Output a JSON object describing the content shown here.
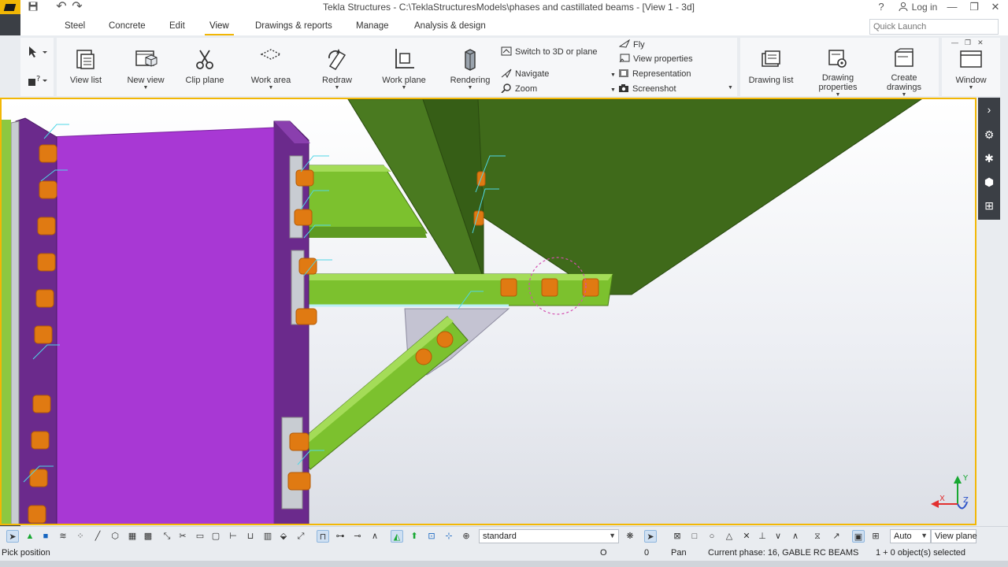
{
  "window": {
    "title": "Tekla Structures - C:\\TeklaStructuresModels\\phases and castillated beams  - [View 1 - 3d]",
    "help_glyph": "?",
    "login_label": "Log in",
    "minimize_glyph": "—",
    "restore_glyph": "❐",
    "close_glyph": "✕"
  },
  "quick_access": {
    "undo_glyph": "↶",
    "redo_glyph": "↷"
  },
  "menu": {
    "tabs": [
      "Steel",
      "Concrete",
      "Edit",
      "View",
      "Drawings & reports",
      "Manage",
      "Analysis & design"
    ],
    "active_tab": "View",
    "quick_launch_placeholder": "Quick Launch"
  },
  "ribbon": {
    "buttons": {
      "view_list": "View list",
      "new_view": "New view",
      "clip_plane": "Clip plane",
      "work_area": "Work area",
      "redraw": "Redraw",
      "work_plane": "Work plane",
      "rendering": "Rendering",
      "drawing_list": "Drawing list",
      "drawing_properties_1": "Drawing",
      "drawing_properties_2": "properties",
      "create_drawings_1": "Create",
      "create_drawings_2": "drawings",
      "window": "Window"
    },
    "small_items": {
      "switch_3d": "Switch to 3D or plane",
      "navigate": "Navigate",
      "zoom": "Zoom",
      "fly": "Fly",
      "view_properties": "View properties",
      "representation": "Representation",
      "screenshot": "Screenshot"
    }
  },
  "viewport": {
    "name": "View 1 - 3d",
    "axis_labels": {
      "x": "X",
      "y": "Y",
      "z": "Z"
    },
    "colors": {
      "column": "#9b35c9",
      "column_flange": "#5c1f78",
      "beam_light": "#7cc12e",
      "beam_dark": "#3f6a1a",
      "bolt": "#e07a12",
      "highlight_circle": "#d44fb0"
    }
  },
  "bottom_toolbar": {
    "filter_value": "standard",
    "snap_mode": "Auto",
    "plane_mode": "View plane"
  },
  "status": {
    "prompt": "Pick position",
    "coord_1": "O",
    "coord_2": "0",
    "mode": "Pan",
    "current_phase": "Current phase: 16, GABLE RC BEAMS",
    "selection": "1 + 0 object(s) selected"
  }
}
